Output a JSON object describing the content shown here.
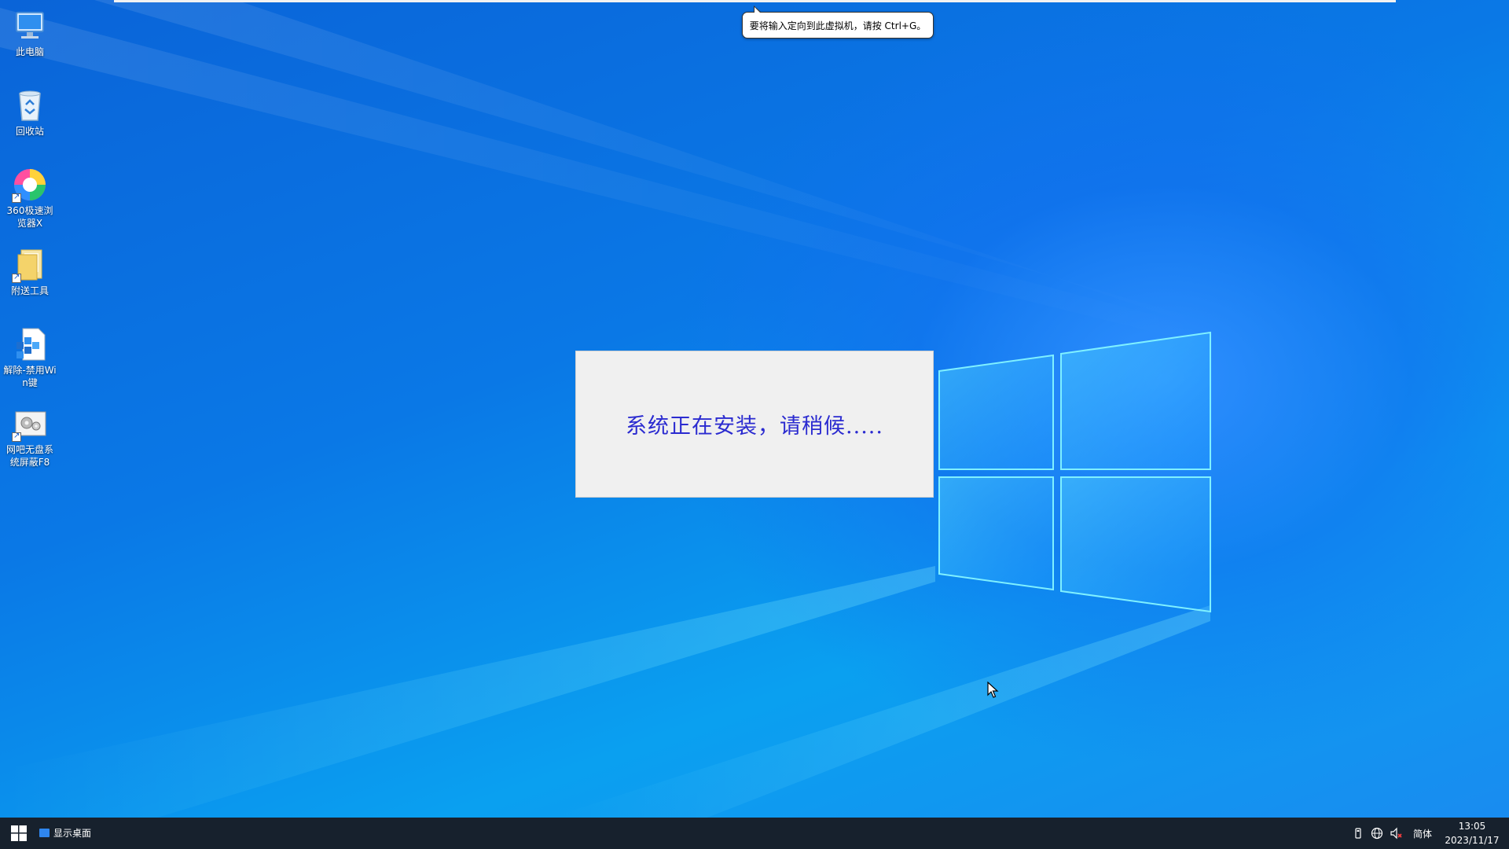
{
  "top_tooltip": {
    "text": "要将输入定向到此虚拟机，请按 Ctrl+G。"
  },
  "desktop_icons": [
    {
      "label": "此电脑",
      "icon": "computer-icon"
    },
    {
      "label": "回收站",
      "icon": "recycle-bin-icon"
    },
    {
      "label": "360极速浏览器X",
      "icon": "browser-360-icon"
    },
    {
      "label": "附送工具",
      "icon": "folder-icon"
    },
    {
      "label": "解除-禁用Win键",
      "icon": "registry-icon"
    },
    {
      "label": "网吧无盘系统屏蔽F8",
      "icon": "settings-file-icon"
    }
  ],
  "install_dialog": {
    "message": "系统正在安装，请稍候....."
  },
  "taskbar": {
    "start_icon": "windows-start-icon",
    "show_desktop_label": "显示桌面",
    "tray": {
      "ime_label": "简体",
      "time": "13:05",
      "date": "2023/11/17",
      "icons": [
        "usb-icon",
        "network-globe-icon",
        "speaker-muted-icon"
      ]
    }
  },
  "colors": {
    "dialog_text": "#2b2bd0",
    "taskbar": "#17212d",
    "desktop": "#0a78e6"
  }
}
